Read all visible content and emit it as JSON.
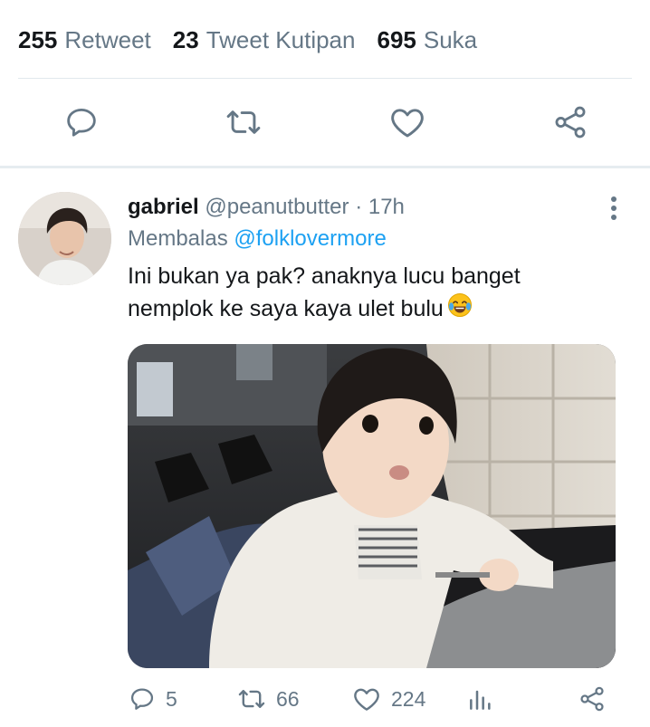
{
  "stats": {
    "retweets": {
      "count": "255",
      "label": "Retweet"
    },
    "quotes": {
      "count": "23",
      "label": "Tweet Kutipan"
    },
    "likes": {
      "count": "695",
      "label": "Suka"
    }
  },
  "main_actions": [
    "reply-icon",
    "retweet-icon",
    "like-icon",
    "share-icon"
  ],
  "reply_tweet": {
    "name": "gabriel",
    "handle": "@peanutbutter",
    "separator": "·",
    "time": "17h",
    "replying_prefix": "Membalas",
    "replying_to": "@folklovermore",
    "text_line1": "Ini bukan ya pak? anaknya lucu banget",
    "text_line2": "nemplok ke saya kaya ulet bulu",
    "emoji": "face-with-tears-of-joy",
    "counts": {
      "replies": "5",
      "retweets": "66",
      "likes": "224"
    }
  },
  "colors": {
    "accent": "#1da1f2",
    "muted": "#657786",
    "text": "#14171a",
    "border": "#e1e8ed"
  }
}
